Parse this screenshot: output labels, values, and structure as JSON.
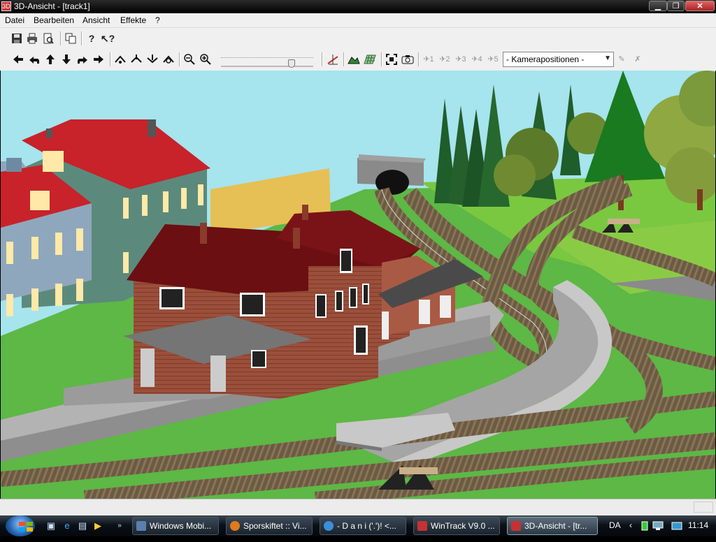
{
  "window": {
    "title": "3D-Ansicht - [track1]",
    "app_icon": "3D",
    "controls": {
      "minimize": "▁",
      "maximize": "❐",
      "close": "✕"
    }
  },
  "menubar": {
    "items": [
      "Datei",
      "Bearbeiten",
      "Ansicht",
      "Effekte",
      "?"
    ]
  },
  "toolbar": {
    "file_icons": [
      "save-icon",
      "print-icon",
      "print-preview-icon",
      "copy-icon",
      "help-icon",
      "context-help-icon"
    ],
    "nav_icons": [
      "arrow-left-icon",
      "turn-left-icon",
      "arrow-up-icon",
      "arrow-down-icon",
      "turn-right-icon",
      "arrow-right-icon"
    ],
    "camera_labels": [
      "1",
      "2",
      "3",
      "4",
      "5"
    ],
    "camera_combo": "- Kamerapositionen -"
  },
  "taskbar": {
    "tasks": [
      {
        "label": "Windows Mobi...",
        "color": "#5a7fb0"
      },
      {
        "label": "Sporskiftet :: Vi...",
        "color": "#e07a1a"
      },
      {
        "label": "- D a n i ('.')! <...",
        "color": "#3a8fd8"
      },
      {
        "label": "WinTrack  V9.0 ...",
        "color": "#c33333"
      },
      {
        "label": "3D-Ansicht - [tr...",
        "color": "#c33333"
      }
    ],
    "language": "DA",
    "clock": "11:14"
  }
}
